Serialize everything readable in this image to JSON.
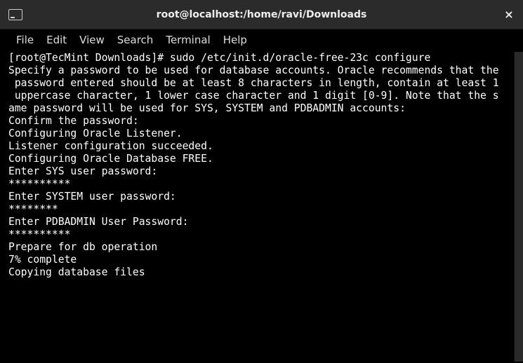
{
  "window": {
    "title": "root@localhost:/home/ravi/Downloads",
    "close_label": "×"
  },
  "menubar": {
    "items": [
      "File",
      "Edit",
      "View",
      "Search",
      "Terminal",
      "Help"
    ]
  },
  "terminal": {
    "lines": [
      "[root@TecMint Downloads]# sudo /etc/init.d/oracle-free-23c configure",
      "Specify a password to be used for database accounts. Oracle recommends that the",
      " password entered should be at least 8 characters in length, contain at least 1",
      " uppercase character, 1 lower case character and 1 digit [0-9]. Note that the s",
      "ame password will be used for SYS, SYSTEM and PDBADMIN accounts:",
      "Confirm the password:",
      "Configuring Oracle Listener.",
      "Listener configuration succeeded.",
      "Configuring Oracle Database FREE.",
      "Enter SYS user password:",
      "**********",
      "Enter SYSTEM user password:",
      "********",
      "Enter PDBADMIN User Password:",
      "**********",
      "Prepare for db operation",
      "7% complete",
      "Copying database files"
    ]
  }
}
